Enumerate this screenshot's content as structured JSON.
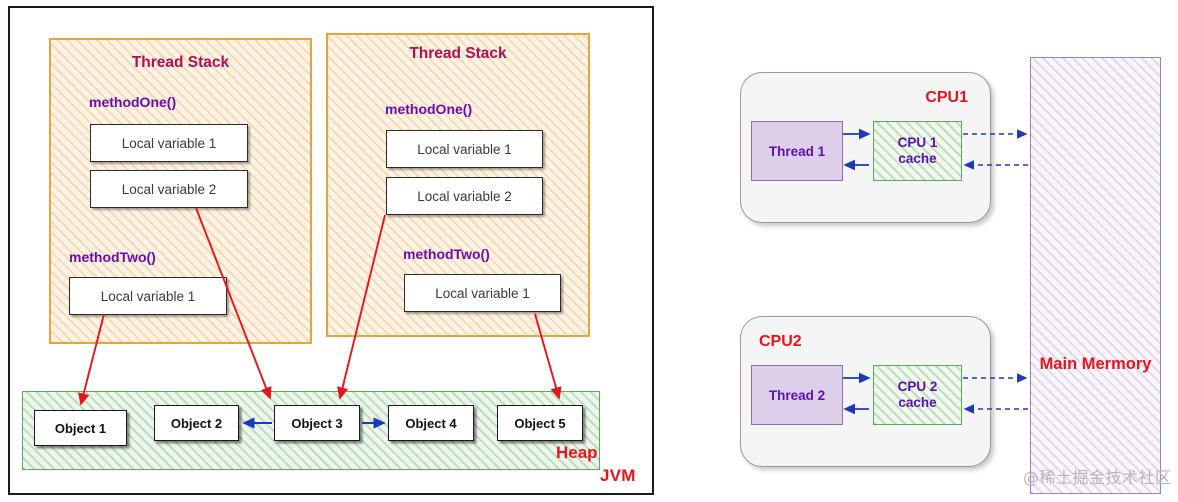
{
  "jvm": {
    "label": "JVM",
    "heap_label": "Heap",
    "thread_stacks": [
      {
        "title": "Thread Stack",
        "methods": [
          {
            "name": "methodOne()",
            "variables": [
              "Local variable 1",
              "Local variable 2"
            ]
          },
          {
            "name": "methodTwo()",
            "variables": [
              "Local variable 1"
            ]
          }
        ]
      },
      {
        "title": "Thread Stack",
        "methods": [
          {
            "name": "methodOne()",
            "variables": [
              "Local variable 1",
              "Local variable 2"
            ]
          },
          {
            "name": "methodTwo()",
            "variables": [
              "Local variable 1"
            ]
          }
        ]
      }
    ],
    "heap_objects": [
      "Object 1",
      "Object 2",
      "Object 3",
      "Object 4",
      "Object 5"
    ]
  },
  "memory_model": {
    "cpus": [
      {
        "title": "CPU1",
        "thread": "Thread 1",
        "cache_line_1": "CPU 1",
        "cache_line_2": "cache"
      },
      {
        "title": "CPU2",
        "thread": "Thread 2",
        "cache_line_1": "CPU 2",
        "cache_line_2": "cache"
      }
    ],
    "main_memory_label": "Main Mermory"
  },
  "watermark": "@稀土掘金技术社区",
  "colors": {
    "label_red": "#e8141b",
    "thread_stack_title": "#B01055",
    "method_purple": "#6A0DAD",
    "stack_border": "#E8A33D",
    "heap_border": "#5aa85a",
    "memory_border": "#9c7fc0",
    "red_arrow": "#e8141b",
    "blue_arrow": "#1c39bb"
  }
}
